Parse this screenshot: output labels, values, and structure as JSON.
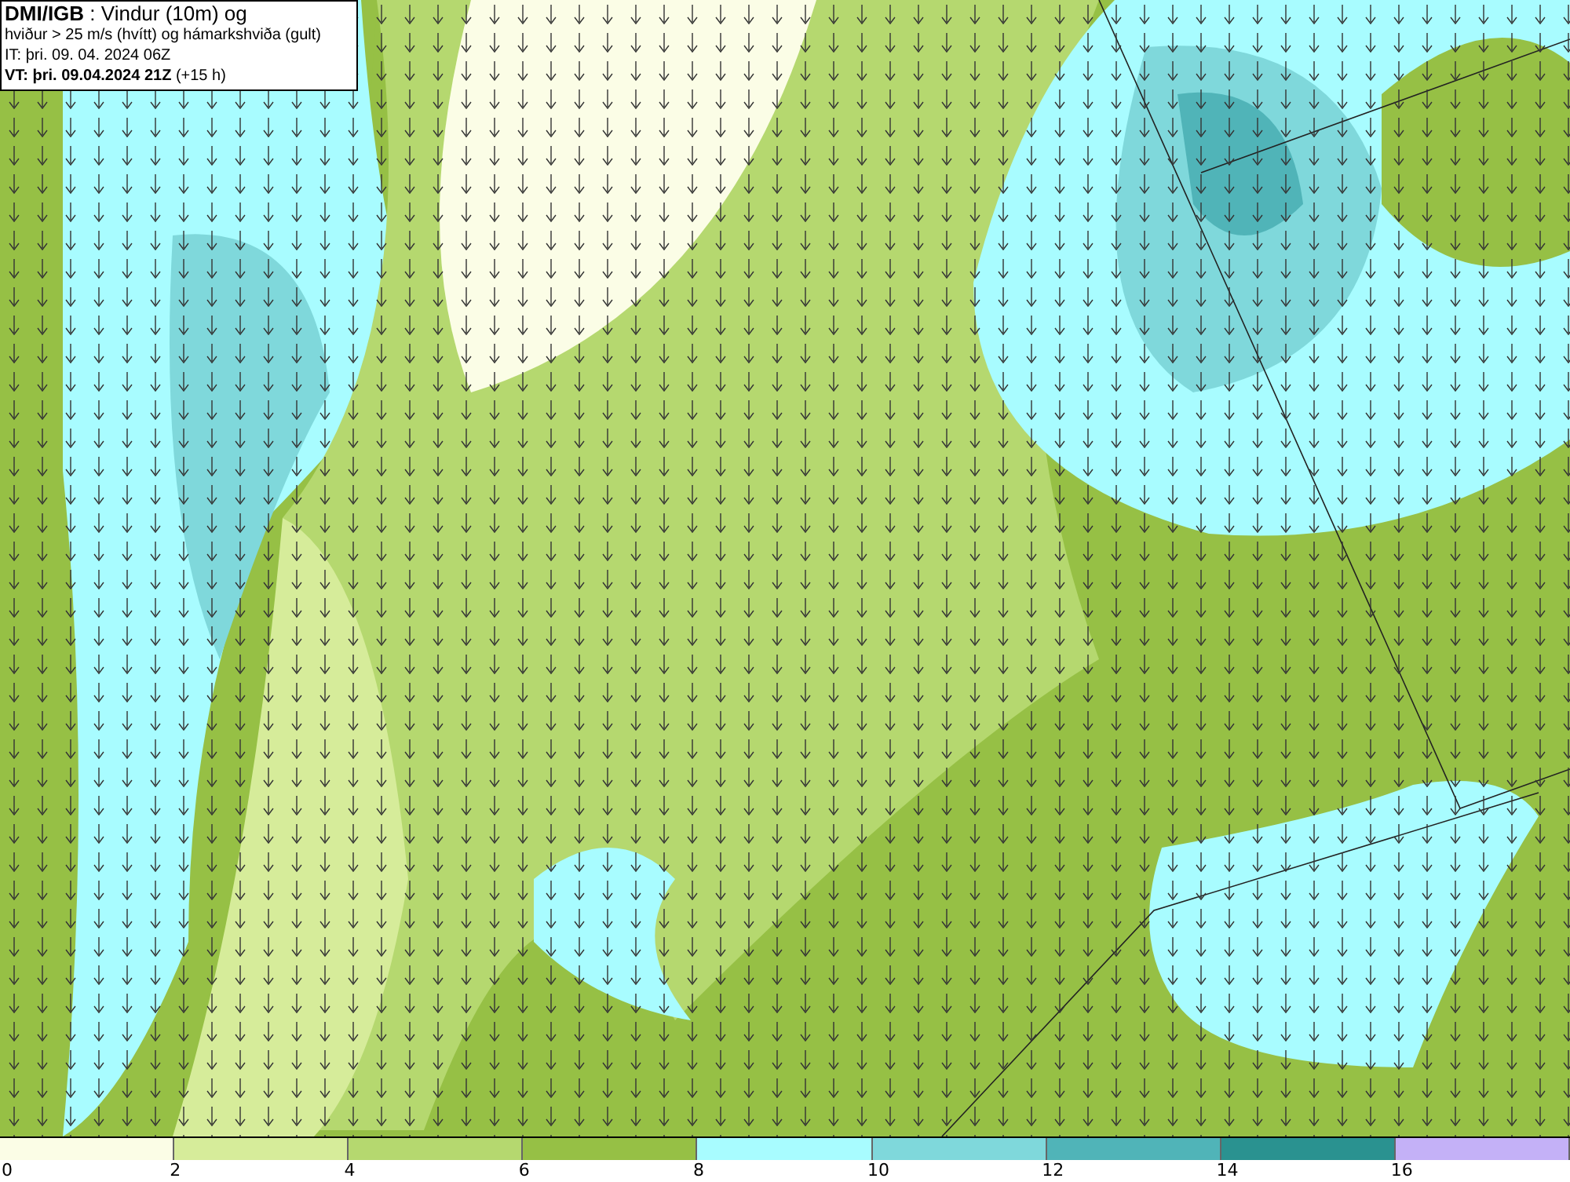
{
  "info_box": {
    "lines": [
      "**DMI/IGB** : Vindur (10m) og",
      "hviður > 25 m/s (hvítt) og hámarkshviða (gult)",
      "IT: þri. 09. 04. 2024 06Z",
      "**VT: þri. 09.04.2024 21Z** (+15 h)"
    ]
  },
  "legend": {
    "swatches": [
      {
        "color": "#fbfde6"
      },
      {
        "color": "#d6ec9a"
      },
      {
        "color": "#b5d86f"
      },
      {
        "color": "#96c045"
      },
      {
        "color": "#a8fcff"
      },
      {
        "color": "#7fd8db"
      },
      {
        "color": "#50b4b8"
      },
      {
        "color": "#2a9290"
      },
      {
        "color": "#c4b1f7"
      }
    ],
    "ticks": [
      "0",
      "2",
      "4",
      "6",
      "8",
      "10",
      "12",
      "14",
      "16"
    ]
  }
}
